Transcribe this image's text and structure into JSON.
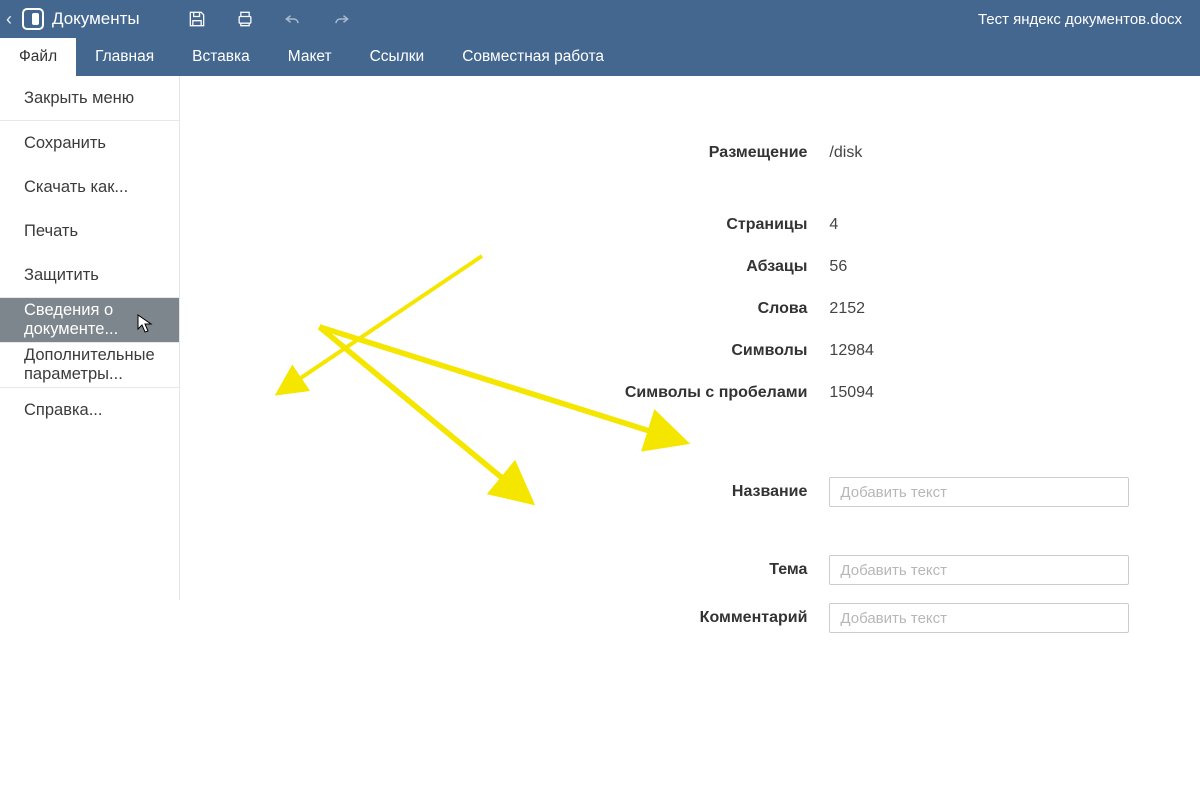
{
  "titlebar": {
    "app_title": "Документы",
    "document_name": "Тест яндекс документов.docx"
  },
  "menubar": {
    "items": [
      "Файл",
      "Главная",
      "Вставка",
      "Макет",
      "Ссылки",
      "Совместная работа"
    ],
    "active_index": 0
  },
  "sidebar": {
    "close_menu": "Закрыть меню",
    "save": "Сохранить",
    "download_as": "Скачать как...",
    "print": "Печать",
    "protect": "Защитить",
    "doc_info": "Сведения о документе...",
    "advanced": "Дополнительные параметры...",
    "help": "Справка..."
  },
  "info": {
    "location_label": "Размещение",
    "location_value": "/disk",
    "pages_label": "Страницы",
    "pages_value": "4",
    "paragraphs_label": "Абзацы",
    "paragraphs_value": "56",
    "words_label": "Слова",
    "words_value": "2152",
    "chars_label": "Символы",
    "chars_value": "12984",
    "chars_sp_label": "Символы с пробелами",
    "chars_sp_value": "15094",
    "title_label": "Название",
    "subject_label": "Тема",
    "comment_label": "Комментарий",
    "placeholder": "Добавить текст"
  }
}
